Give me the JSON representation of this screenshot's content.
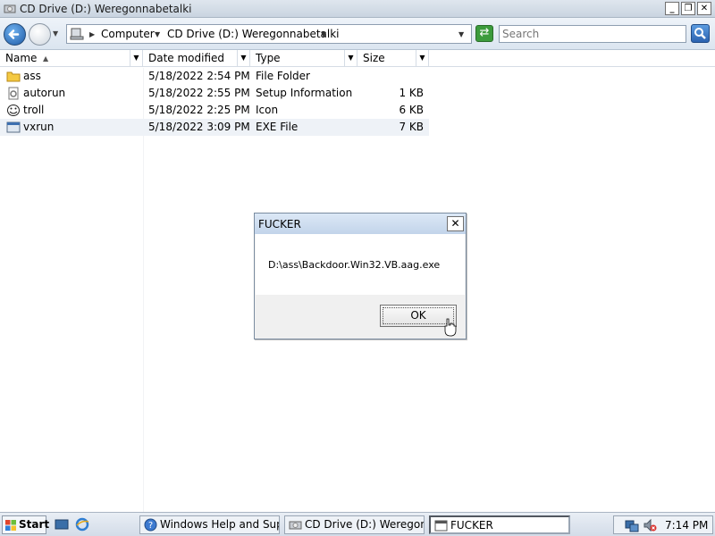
{
  "window": {
    "title": "CD Drive (D:) Weregonnabetalki",
    "min_label": "_",
    "max_label": "❐",
    "close_label": "✕"
  },
  "toolbar": {
    "breadcrumb": [
      "Computer",
      "CD Drive (D:) Weregonnabetalki"
    ],
    "search_placeholder": "Search"
  },
  "columns": [
    {
      "label": "Name"
    },
    {
      "label": "Date modified"
    },
    {
      "label": "Type"
    },
    {
      "label": "Size"
    }
  ],
  "files": [
    {
      "name": "ass",
      "date": "5/18/2022 2:54 PM",
      "type": "File Folder",
      "size": "",
      "icon": "folder-icon"
    },
    {
      "name": "autorun",
      "date": "5/18/2022 2:55 PM",
      "type": "Setup Information",
      "size": "1 KB",
      "icon": "setup-file-icon"
    },
    {
      "name": "troll",
      "date": "5/18/2022 2:25 PM",
      "type": "Icon",
      "size": "6 KB",
      "icon": "troll-icon"
    },
    {
      "name": "vxrun",
      "date": "5/18/2022 3:09 PM",
      "type": "EXE File",
      "size": "7 KB",
      "icon": "exe-file-icon"
    }
  ],
  "dialog": {
    "title": "FUCKER",
    "message": "D:\\ass\\Backdoor.Win32.VB.aag.exe",
    "ok_label": "OK",
    "close_label": "✕"
  },
  "taskbar": {
    "start_label": "Start",
    "tasks": [
      {
        "label": "Windows Help and Sup..."
      },
      {
        "label": "CD Drive (D:) Weregon..."
      },
      {
        "label": "FUCKER"
      }
    ],
    "clock": "7:14 PM"
  }
}
